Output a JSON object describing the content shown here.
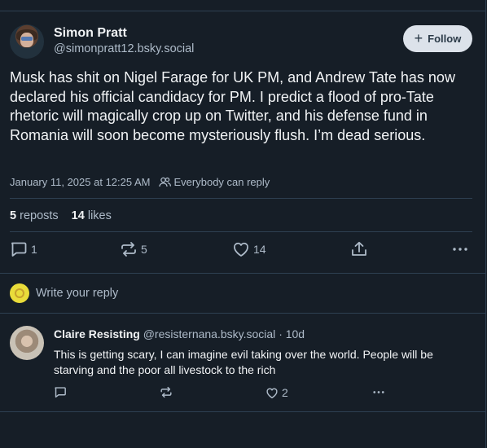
{
  "post": {
    "author": {
      "name": "Simon Pratt",
      "handle": "@simonpratt12.bsky.social"
    },
    "follow_label": "Follow",
    "text": "Musk has shit on Nigel Farage for UK PM, and Andrew Tate has now declared his official candidacy for PM. I predict a flood of pro-Tate rhetoric will magically crop up on Twitter, and his defense fund in Romania will soon become mysteriously flush. I’m dead serious.",
    "timestamp": "January 11, 2025 at 12:25 AM",
    "reply_setting": "Everybody can reply",
    "stats": {
      "reposts_count": "5",
      "reposts_label": "reposts",
      "likes_count": "14",
      "likes_label": "likes"
    },
    "actions": {
      "reply_count": "1",
      "repost_count": "5",
      "like_count": "14"
    }
  },
  "compose": {
    "placeholder": "Write your reply"
  },
  "reply": {
    "author": {
      "name": "Claire Resisting",
      "handle": "@resisternana.bsky.social",
      "age": "· 10d"
    },
    "text": "This is getting scary, I can imagine evil taking over the world. People will be starving and the poor all livestock to the rich",
    "actions": {
      "like_count": "2"
    }
  },
  "icons": {
    "follow": "plus-icon",
    "reply_setting": "people-icon",
    "reply": "speech-bubble-icon",
    "repost": "repost-arrows-icon",
    "like": "heart-icon",
    "share": "share-upload-icon",
    "more": "more-dots-icon"
  },
  "colors": {
    "background": "#161e27",
    "divider": "#2e4052",
    "text": "#f1f3f5",
    "muted": "#aebbc9",
    "follow_bg": "#dce2ea"
  }
}
